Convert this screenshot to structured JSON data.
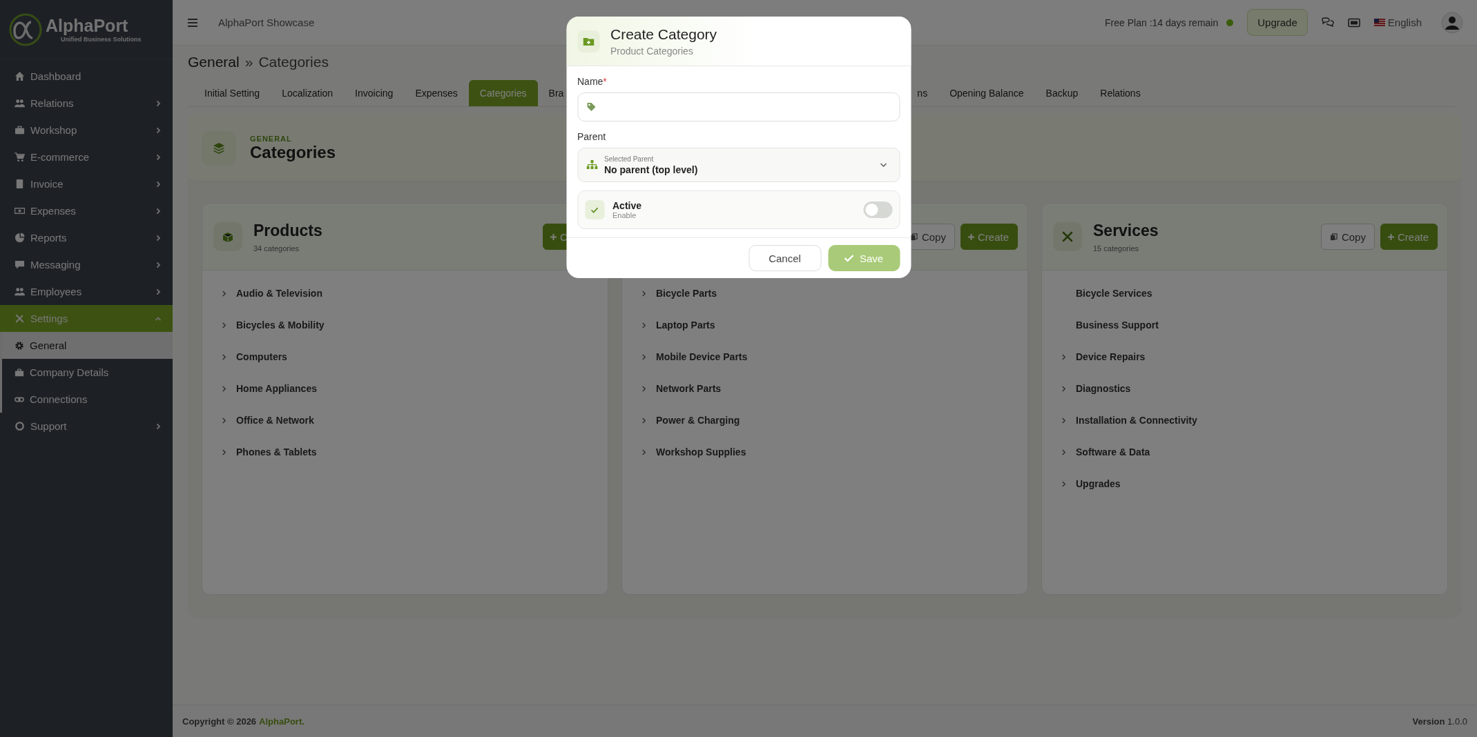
{
  "brand": {
    "name": "AlphaPort",
    "tagline": "Unified Business Solutions"
  },
  "sidebar": {
    "items": [
      {
        "label": "Dashboard",
        "has_submenu": false,
        "selected": false
      },
      {
        "label": "Relations",
        "has_submenu": true,
        "expanded": false,
        "selected": false
      },
      {
        "label": "Workshop",
        "has_submenu": true,
        "expanded": false,
        "selected": false
      },
      {
        "label": "E-commerce",
        "has_submenu": true,
        "expanded": false,
        "selected": false
      },
      {
        "label": "Invoice",
        "has_submenu": true,
        "expanded": false,
        "selected": false
      },
      {
        "label": "Expenses",
        "has_submenu": true,
        "expanded": false,
        "selected": false
      },
      {
        "label": "Reports",
        "has_submenu": true,
        "expanded": false,
        "selected": false
      },
      {
        "label": "Messaging",
        "has_submenu": true,
        "expanded": false,
        "selected": false
      },
      {
        "label": "Employees",
        "has_submenu": true,
        "expanded": false,
        "selected": false
      },
      {
        "label": "Settings",
        "has_submenu": true,
        "expanded": true,
        "selected": true,
        "children": [
          {
            "label": "General",
            "selected": true
          },
          {
            "label": "Company Details",
            "selected": false
          },
          {
            "label": "Connections",
            "selected": false
          }
        ]
      },
      {
        "label": "Support",
        "has_submenu": true,
        "expanded": false,
        "selected": false
      }
    ]
  },
  "header": {
    "title": "AlphaPort Showcase",
    "plan": "Free Plan :14 days remain",
    "upgrade": "Upgrade",
    "language": "English"
  },
  "breadcrumb": {
    "parent": "General",
    "separator": "»",
    "current": "Categories"
  },
  "tabs": [
    {
      "label": "Initial Setting",
      "selected": false
    },
    {
      "label": "Localization",
      "selected": false
    },
    {
      "label": "Invoicing",
      "selected": false
    },
    {
      "label": "Expenses",
      "selected": false
    },
    {
      "label": "Categories",
      "selected": true
    },
    {
      "label": "Bra",
      "selected": false
    },
    {
      "label": "ns",
      "selected": false
    },
    {
      "label": "Opening Balance",
      "selected": false
    },
    {
      "label": "Backup",
      "selected": false
    },
    {
      "label": "Relations",
      "selected": false
    }
  ],
  "section": {
    "kicker": "GENERAL",
    "title": "Categories"
  },
  "cards": [
    {
      "title": "Products",
      "count": "34 categories",
      "buttons": [
        {
          "label": "C",
          "kind": "create"
        }
      ],
      "items": [
        {
          "label": "Audio & Television",
          "has_children": true
        },
        {
          "label": "Bicycles & Mobility",
          "has_children": true
        },
        {
          "label": "Computers",
          "has_children": true
        },
        {
          "label": "Home Appliances",
          "has_children": true
        },
        {
          "label": "Office & Network",
          "has_children": true
        },
        {
          "label": "Phones & Tablets",
          "has_children": true
        }
      ]
    },
    {
      "buttons": [
        {
          "label": "Copy",
          "kind": "copy"
        },
        {
          "label": "Create",
          "kind": "create"
        }
      ],
      "items": [
        {
          "label": "Bicycle Parts",
          "has_children": true
        },
        {
          "label": "Laptop Parts",
          "has_children": true
        },
        {
          "label": "Mobile Device Parts",
          "has_children": true
        },
        {
          "label": "Network Parts",
          "has_children": true
        },
        {
          "label": "Power & Charging",
          "has_children": true
        },
        {
          "label": "Workshop Supplies",
          "has_children": true
        }
      ]
    },
    {
      "title": "Services",
      "count": "15 categories",
      "buttons": [
        {
          "label": "Copy",
          "kind": "copy"
        },
        {
          "label": "Create",
          "kind": "create"
        }
      ],
      "items": [
        {
          "label": "Bicycle Services",
          "has_children": false
        },
        {
          "label": "Business Support",
          "has_children": false
        },
        {
          "label": "Device Repairs",
          "has_children": true
        },
        {
          "label": "Diagnostics",
          "has_children": true
        },
        {
          "label": "Installation & Connectivity",
          "has_children": true
        },
        {
          "label": "Software & Data",
          "has_children": true
        },
        {
          "label": "Upgrades",
          "has_children": true
        }
      ]
    }
  ],
  "footer": {
    "copyright": "Copyright © 2026",
    "company": "AlphaPort.",
    "version": "**Version** 1.0.0"
  },
  "modal": {
    "title": "Create Category",
    "subtitle": "Product Categories",
    "name_field": {
      "label": "Name",
      "required_mark": "*"
    },
    "parent_field": {
      "label": "Parent",
      "caption": "Selected Parent",
      "value": "No parent (top level)"
    },
    "active": {
      "label": "Active",
      "hint": "Enable",
      "on": false
    },
    "buttons": [
      {
        "label": "Cancel",
        "kind": "cancel"
      },
      {
        "label": "Save",
        "kind": "save"
      }
    ]
  }
}
